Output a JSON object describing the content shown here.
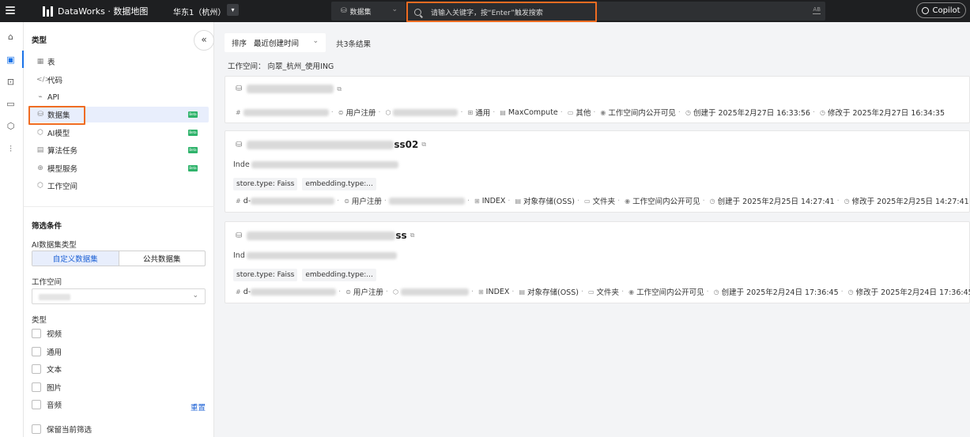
{
  "topbar": {
    "app_title": "DataWorks · 数据地图",
    "region": "华东1（杭州）",
    "type_select": "数据集",
    "search_placeholder": "请输入关键字，按“Enter”触发搜索",
    "search_shortcut": "AB",
    "copilot": "Copilot"
  },
  "rail": {
    "icons": [
      "home-icon",
      "data-map-icon",
      "briefcase-icon",
      "monitor-icon",
      "cube-icon",
      "sliders-icon"
    ]
  },
  "sidepanel": {
    "category_title": "类型",
    "types": [
      {
        "label": "表",
        "icon": "▦",
        "beta": false
      },
      {
        "label": "代码",
        "icon": "</>",
        "beta": false
      },
      {
        "label": "API",
        "icon": "⌁",
        "beta": false
      },
      {
        "label": "数据集",
        "icon": "⛁",
        "beta": true
      },
      {
        "label": "AI模型",
        "icon": "⬡",
        "beta": true
      },
      {
        "label": "算法任务",
        "icon": "▤",
        "beta": true
      },
      {
        "label": "模型服务",
        "icon": "⊕",
        "beta": true
      },
      {
        "label": "工作空间",
        "icon": "⬡",
        "beta": false
      }
    ],
    "beta_label": "Beta",
    "filter_title": "筛选条件",
    "ai_dataset_type_label": "AI数据集类型",
    "seg_custom": "自定义数据集",
    "seg_public": "公共数据集",
    "workspace_label": "工作空间",
    "type_label": "类型",
    "type_options": [
      "视频",
      "通用",
      "文本",
      "图片",
      "音频"
    ],
    "keep_filter": "保留当前筛选",
    "reset": "重置"
  },
  "main": {
    "sort_label": "排序",
    "sort_value": "最近创建时间",
    "total": "共3条结果",
    "workspace_line": "工作空间：  向翠_杭州_使用ING",
    "cards": [
      {
        "title_suffix": "",
        "desc_prefix": "",
        "chips": [],
        "meta": {
          "id_prefix": "",
          "registered": "用户注册",
          "kind": "通用",
          "storage": "MaxCompute",
          "folder": "其他",
          "visibility": "工作空间内公开可见",
          "created": "创建于 2025年2月27日 16:33:56",
          "modified": "修改于 2025年2月27日 16:34:35"
        }
      },
      {
        "title_suffix": "ss02",
        "desc_prefix": "Inde",
        "chips": [
          "store.type: Faiss",
          "embedding.type:..."
        ],
        "meta": {
          "id_prefix": "d-",
          "registered": "用户注册",
          "kind": "INDEX",
          "storage": "对象存储(OSS)",
          "folder": "文件夹",
          "visibility": "工作空间内公开可见",
          "created": "创建于 2025年2月25日 14:27:41",
          "modified": "修改于 2025年2月25日 14:27:41"
        }
      },
      {
        "title_suffix": "ss",
        "desc_prefix": "Ind",
        "chips": [
          "store.type: Faiss",
          "embedding.type:..."
        ],
        "meta": {
          "id_prefix": "d-",
          "registered": "用户注册",
          "kind": "INDEX",
          "storage": "对象存储(OSS)",
          "folder": "文件夹",
          "visibility": "工作空间内公开可见",
          "created": "创建于 2025年2月24日 17:36:45",
          "modified": "修改于 2025年2月24日 17:36:45"
        }
      }
    ]
  },
  "colors": {
    "accent": "#1a73e8",
    "highlight": "#ef6c22",
    "beta": "#2fb36b",
    "topbar": "#1e1f21"
  }
}
